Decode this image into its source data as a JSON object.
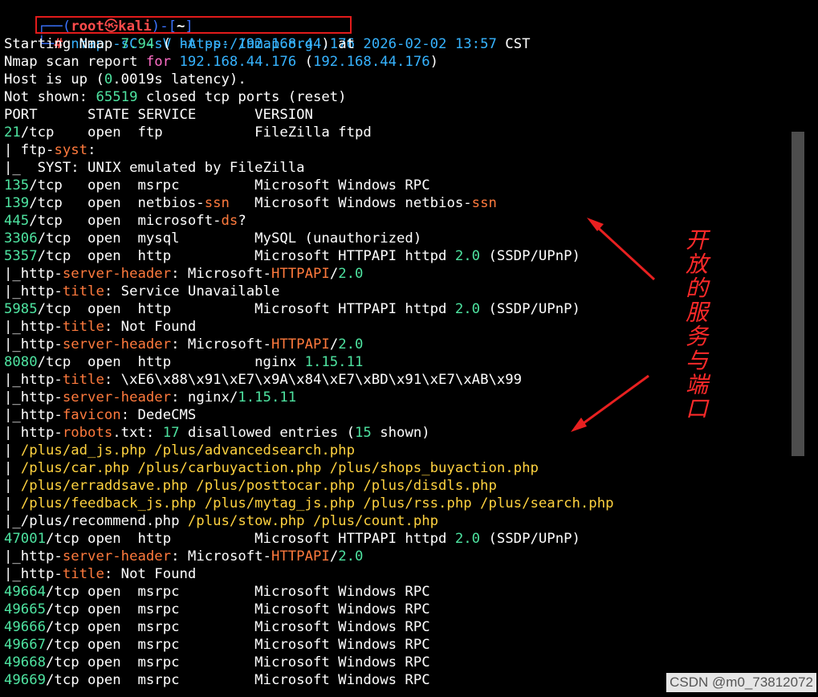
{
  "prompt": {
    "open_bracket": "(",
    "user": "root",
    "at_symbol": "㉿",
    "host": "kali",
    "close_bracket": ")",
    "dash": "-",
    "dir_open": "[",
    "dir": "~",
    "dir_close": "]",
    "hash": "#",
    "command": "nmap -sC -sV -A -p- 192.168.44.176"
  },
  "output_lines": [
    [
      [
        "Starting Nmap ",
        "white"
      ],
      [
        "7.94",
        "green"
      ],
      [
        " ( ",
        "white"
      ],
      [
        "https://nmap.org",
        "cyan"
      ],
      [
        " ) at ",
        "white"
      ],
      [
        "2026-02-02",
        "cyan"
      ],
      [
        " ",
        "white"
      ],
      [
        "13:57",
        "cyan"
      ],
      [
        " CST",
        "white"
      ]
    ],
    [
      [
        "Nmap scan report ",
        "white"
      ],
      [
        "for",
        "pink"
      ],
      [
        " ",
        "white"
      ],
      [
        "192.168.44.176",
        "cyan"
      ],
      [
        " (",
        "white"
      ],
      [
        "192.168.44.176",
        "cyan"
      ],
      [
        ")",
        "white"
      ]
    ],
    [
      [
        "Host is up (",
        "white"
      ],
      [
        "0",
        "green"
      ],
      [
        ".0019s latency).",
        "white"
      ]
    ],
    [
      [
        "Not shown: ",
        "white"
      ],
      [
        "65519",
        "green"
      ],
      [
        " closed tcp ports (reset)",
        "white"
      ]
    ],
    [
      [
        "PORT      STATE SERVICE       VERSION",
        "white"
      ]
    ],
    [
      [
        "21",
        "green"
      ],
      [
        "/tcp    open  ftp           FileZilla ftpd",
        "white"
      ]
    ],
    [
      [
        "| ftp-",
        "white"
      ],
      [
        "syst",
        "orange"
      ],
      [
        ":",
        "white"
      ]
    ],
    [
      [
        "|_  SYST: UNIX emulated by FileZilla",
        "white"
      ]
    ],
    [
      [
        "135",
        "green"
      ],
      [
        "/tcp   open  msrpc         Microsoft Windows RPC",
        "white"
      ]
    ],
    [
      [
        "139",
        "green"
      ],
      [
        "/tcp   open  netbios-",
        "white"
      ],
      [
        "ssn",
        "orange"
      ],
      [
        "   Microsoft Windows netbios-",
        "white"
      ],
      [
        "ssn",
        "orange"
      ]
    ],
    [
      [
        "445",
        "green"
      ],
      [
        "/tcp   open  microsoft-",
        "white"
      ],
      [
        "ds",
        "orange"
      ],
      [
        "?",
        "white"
      ]
    ],
    [
      [
        "3306",
        "green"
      ],
      [
        "/tcp  open  mysql         MySQL (unauthorized)",
        "white"
      ]
    ],
    [
      [
        "5357",
        "green"
      ],
      [
        "/tcp  open  http          Microsoft HTTPAPI httpd ",
        "white"
      ],
      [
        "2.0",
        "green"
      ],
      [
        " (SSDP/UPnP)",
        "white"
      ]
    ],
    [
      [
        "|_http-",
        "white"
      ],
      [
        "server-header",
        "orange"
      ],
      [
        ": Microsoft-",
        "white"
      ],
      [
        "HTTPAPI",
        "orange"
      ],
      [
        "/",
        "white"
      ],
      [
        "2.0",
        "green"
      ]
    ],
    [
      [
        "|_http-",
        "white"
      ],
      [
        "title",
        "orange"
      ],
      [
        ": Service Unavailable",
        "white"
      ]
    ],
    [
      [
        "5985",
        "green"
      ],
      [
        "/tcp  open  http          Microsoft HTTPAPI httpd ",
        "white"
      ],
      [
        "2.0",
        "green"
      ],
      [
        " (SSDP/UPnP)",
        "white"
      ]
    ],
    [
      [
        "|_http-",
        "white"
      ],
      [
        "title",
        "orange"
      ],
      [
        ": Not Found",
        "white"
      ]
    ],
    [
      [
        "|_http-",
        "white"
      ],
      [
        "server-header",
        "orange"
      ],
      [
        ": Microsoft-",
        "white"
      ],
      [
        "HTTPAPI",
        "orange"
      ],
      [
        "/",
        "white"
      ],
      [
        "2.0",
        "green"
      ]
    ],
    [
      [
        "8080",
        "green"
      ],
      [
        "/tcp  open  http          nginx ",
        "white"
      ],
      [
        "1.15.11",
        "green"
      ]
    ],
    [
      [
        "|_http-",
        "white"
      ],
      [
        "title",
        "orange"
      ],
      [
        ": \\xE6\\x88\\x91\\xE7\\x9A\\x84\\xE7\\xBD\\x91\\xE7\\xAB\\x99",
        "white"
      ]
    ],
    [
      [
        "|_http-",
        "white"
      ],
      [
        "server-header",
        "orange"
      ],
      [
        ": nginx/",
        "white"
      ],
      [
        "1.15.11",
        "green"
      ]
    ],
    [
      [
        "|_http-",
        "white"
      ],
      [
        "favicon",
        "orange"
      ],
      [
        ": DedeCMS",
        "white"
      ]
    ],
    [
      [
        "| http-",
        "white"
      ],
      [
        "robots",
        "orange"
      ],
      [
        ".txt: ",
        "white"
      ],
      [
        "17",
        "green"
      ],
      [
        " disallowed entries (",
        "white"
      ],
      [
        "15",
        "green"
      ],
      [
        " shown)",
        "white"
      ]
    ],
    [
      [
        "| ",
        "white"
      ],
      [
        "/plus/ad_js.php /plus/advancedsearch.php",
        "yellow"
      ]
    ],
    [
      [
        "| ",
        "white"
      ],
      [
        "/plus/car.php /plus/carbuyaction.php /plus/shops_buyaction.php",
        "yellow"
      ]
    ],
    [
      [
        "| ",
        "white"
      ],
      [
        "/plus/erraddsave.php /plus/posttocar.php /plus/disdls.php",
        "yellow"
      ]
    ],
    [
      [
        "| ",
        "white"
      ],
      [
        "/plus/feedback_js.php /plus/mytag_js.php /plus/rss.php /plus/search.php",
        "yellow"
      ]
    ],
    [
      [
        "|_/plus/recommend.php ",
        "white"
      ],
      [
        "/plus/stow.php /plus/count.php",
        "yellow"
      ]
    ],
    [
      [
        "47001",
        "green"
      ],
      [
        "/tcp open  http          Microsoft HTTPAPI httpd ",
        "white"
      ],
      [
        "2.0",
        "green"
      ],
      [
        " (SSDP/UPnP)",
        "white"
      ]
    ],
    [
      [
        "|_http-",
        "white"
      ],
      [
        "server-header",
        "orange"
      ],
      [
        ": Microsoft-",
        "white"
      ],
      [
        "HTTPAPI",
        "orange"
      ],
      [
        "/",
        "white"
      ],
      [
        "2.0",
        "green"
      ]
    ],
    [
      [
        "|_http-",
        "white"
      ],
      [
        "title",
        "orange"
      ],
      [
        ": Not Found",
        "white"
      ]
    ],
    [
      [
        "49664",
        "green"
      ],
      [
        "/tcp open  msrpc         Microsoft Windows RPC",
        "white"
      ]
    ],
    [
      [
        "49665",
        "green"
      ],
      [
        "/tcp open  msrpc         Microsoft Windows RPC",
        "white"
      ]
    ],
    [
      [
        "49666",
        "green"
      ],
      [
        "/tcp open  msrpc         Microsoft Windows RPC",
        "white"
      ]
    ],
    [
      [
        "49667",
        "green"
      ],
      [
        "/tcp open  msrpc         Microsoft Windows RPC",
        "white"
      ]
    ],
    [
      [
        "49668",
        "green"
      ],
      [
        "/tcp open  msrpc         Microsoft Windows RPC",
        "white"
      ]
    ],
    [
      [
        "49669",
        "green"
      ],
      [
        "/tcp open  msrpc         Microsoft Windows RPC",
        "white"
      ]
    ]
  ],
  "annotation": {
    "text": "开放的服务与端口",
    "color": "#ff2a2a"
  },
  "watermark": {
    "text": "CSDN @m0_73812072"
  },
  "colors": {
    "background": "#000000",
    "foreground": "#ffffff",
    "number_green": "#4ee3a0",
    "keyword_orange": "#ff7a3d",
    "keyword_pink": "#ff6ec7",
    "link_cyan": "#36b3ff",
    "path_yellow": "#ffd23f",
    "prompt_blue": "#3b73ff",
    "prompt_red": "#ff4c4c",
    "highlight_box_red": "#e21b1b"
  }
}
